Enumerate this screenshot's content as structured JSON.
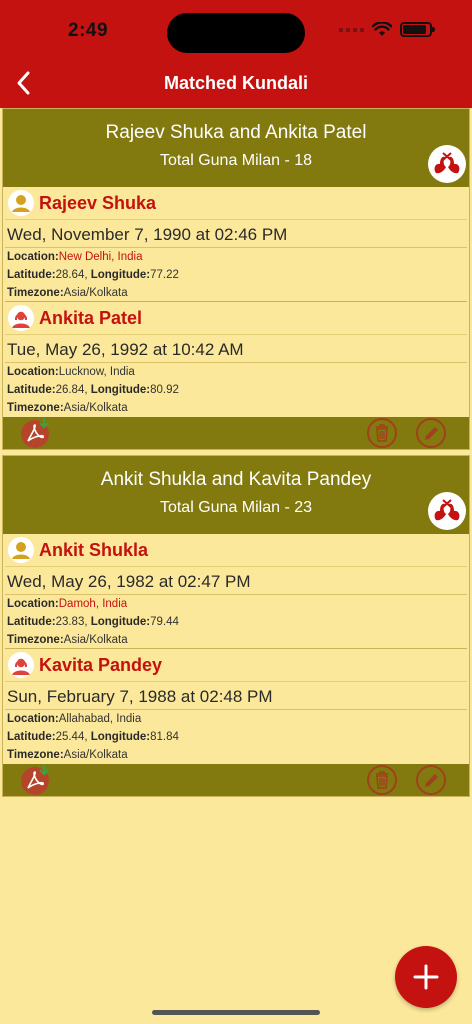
{
  "status": {
    "time": "2:49"
  },
  "nav": {
    "title": "Matched Kundali"
  },
  "labels": {
    "location": "Location:",
    "latitude": "Latitude:",
    "longitude": "Longitude:",
    "timezone": "Timezone:"
  },
  "matches": [
    {
      "title": "Rajeev Shuka and Ankita Patel",
      "guna": "Total Guna Milan - 18",
      "boy": {
        "name": "Rajeev Shuka",
        "datetime": "Wed, November 7, 1990 at 02:46 PM",
        "location": "New Delhi, India",
        "latitude": "28.64",
        "longitude": "77.22",
        "timezone": "Asia/Kolkata"
      },
      "girl": {
        "name": "Ankita Patel",
        "datetime": "Tue, May 26, 1992 at 10:42 AM",
        "location": "Lucknow, India",
        "latitude": "26.84",
        "longitude": "80.92",
        "timezone": "Asia/Kolkata"
      }
    },
    {
      "title": "Ankit Shukla and Kavita Pandey",
      "guna": "Total Guna Milan - 23",
      "boy": {
        "name": "Ankit Shukla",
        "datetime": "Wed, May 26, 1982 at 02:47 PM",
        "location": "Damoh, India",
        "latitude": "23.83",
        "longitude": "79.44",
        "timezone": "Asia/Kolkata"
      },
      "girl": {
        "name": "Kavita Pandey",
        "datetime": "Sun, February 7, 1988 at 02:48 PM",
        "location": "Allahabad, India",
        "latitude": "25.44",
        "longitude": "81.84",
        "timezone": "Asia/Kolkata"
      }
    }
  ],
  "colors": {
    "brand_red": "#c3120f",
    "header_olive": "#837a0f",
    "card_bg": "#fce89a"
  },
  "icons": {
    "back": "chevron-left-icon",
    "match": "swans-match-icon",
    "pdf": "pdf-download-icon",
    "delete": "trash-icon",
    "edit": "pencil-icon",
    "add": "plus-icon"
  }
}
